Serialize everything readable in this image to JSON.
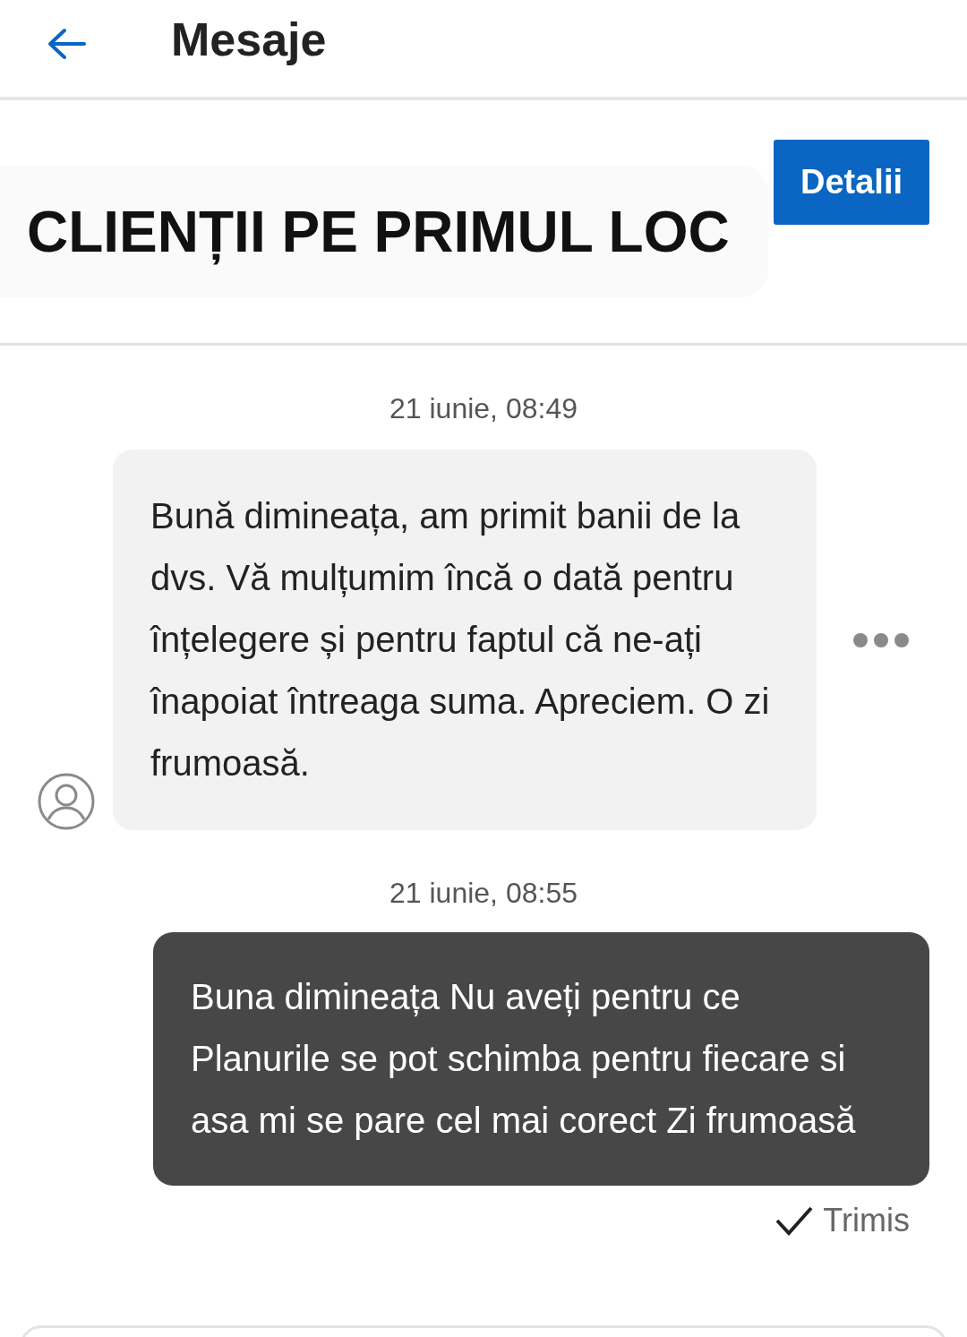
{
  "header": {
    "title": "Mesaje"
  },
  "contact": {
    "button": "Detalii"
  },
  "banner": {
    "text": "CLIENȚII PE PRIMUL LOC"
  },
  "messages": [
    {
      "kind": "received",
      "time": "21 iunie, 08:49",
      "text": "Bună dimineața, am primit banii de la dvs. Vă mulțumim încă o dată pentru înțelegere și pentru faptul că ne-ați înapoiat întreaga suma. Apreciem. O zi frumoasă."
    },
    {
      "kind": "sent",
      "time": "21 iunie, 08:55",
      "text": "Buna dimineața Nu aveți pentru ce Planurile se pot schimba pentru fiecare si asa mi se pare cel mai corect Zi frumoasă",
      "status": "Trimis"
    }
  ]
}
